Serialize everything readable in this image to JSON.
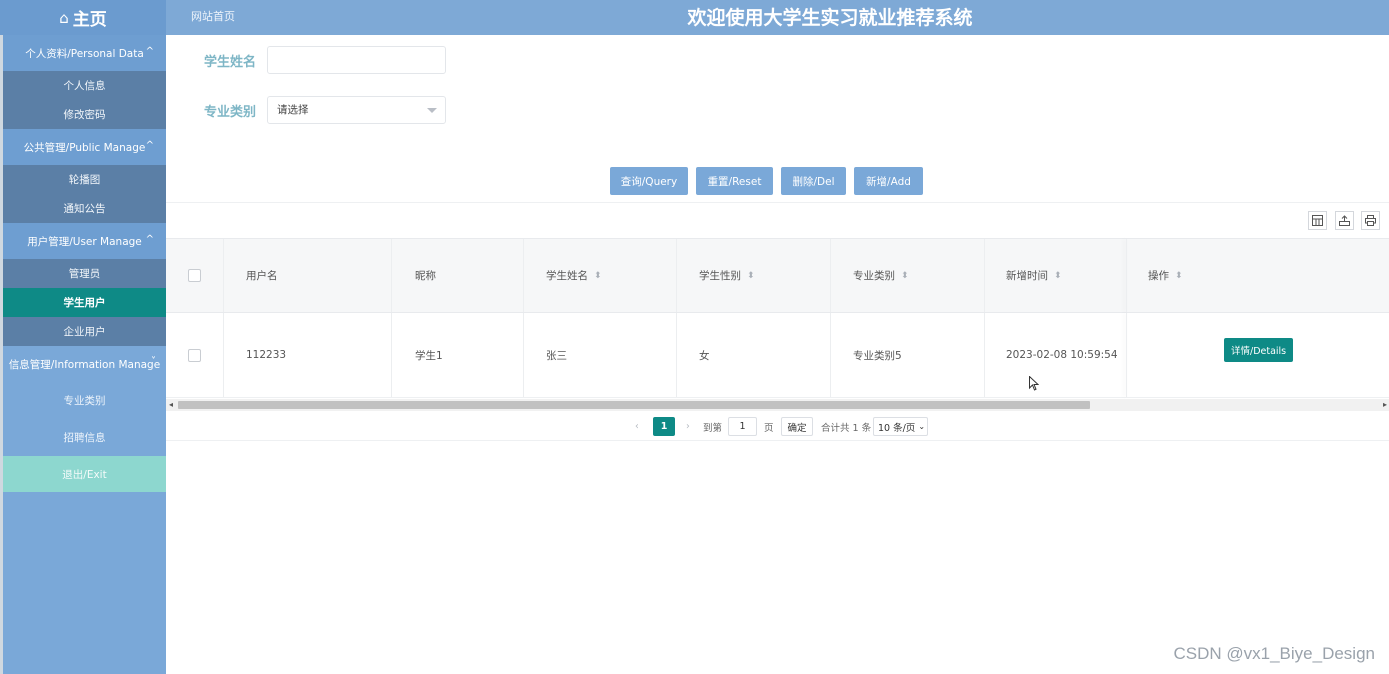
{
  "header": {
    "home_label": "主页",
    "site_link": "网站首页",
    "title": "欢迎使用大学生实习就业推荐系统"
  },
  "sidebar": {
    "groups": [
      {
        "label": "个人资料/Personal Data",
        "caret": "^",
        "items": [
          "个人信息",
          "修改密码"
        ]
      },
      {
        "label": "公共管理/Public Manage",
        "caret": "^",
        "items": [
          "轮播图",
          "通知公告"
        ]
      },
      {
        "label": "用户管理/User Manage",
        "caret": "^",
        "items": [
          "管理员",
          "学生用户",
          "企业用户"
        ]
      },
      {
        "label": "信息管理/Information Manage",
        "caret": "˅",
        "items": [
          "专业类别",
          "招聘信息"
        ]
      }
    ],
    "active_item": "学生用户",
    "exit_label": "退出/Exit"
  },
  "search": {
    "name_label": "学生姓名",
    "name_value": "",
    "major_label": "专业类别",
    "major_selected": "请选择"
  },
  "buttons": {
    "query": "查询/Query",
    "reset": "重置/Reset",
    "delete": "删除/Del",
    "add": "新增/Add"
  },
  "toolbar_icons": [
    "columns-icon",
    "export-icon",
    "print-icon"
  ],
  "table": {
    "columns": [
      "用户名",
      "昵称",
      "学生姓名",
      "学生性别",
      "专业类别",
      "新增时间",
      "操作"
    ],
    "sortable": [
      false,
      false,
      true,
      true,
      true,
      true,
      true
    ],
    "rows": [
      {
        "username": "112233",
        "nickname": "学生1",
        "name": "张三",
        "gender": "女",
        "major": "专业类别5",
        "created": "2023-02-08 10:59:54",
        "action": "详情/Details"
      }
    ]
  },
  "pager": {
    "current_page": "1",
    "goto_prefix": "到第",
    "goto_value": "1",
    "goto_suffix": "页",
    "confirm": "确定",
    "total": "合计共 1 条",
    "page_size": "10 条/页"
  },
  "watermark": "CSDN @vx1_Biye_Design",
  "colors": {
    "primary": "#7aa8d8",
    "teal": "#0e8a86",
    "label": "#7eb6c6",
    "exit": "#8dd7cf"
  }
}
